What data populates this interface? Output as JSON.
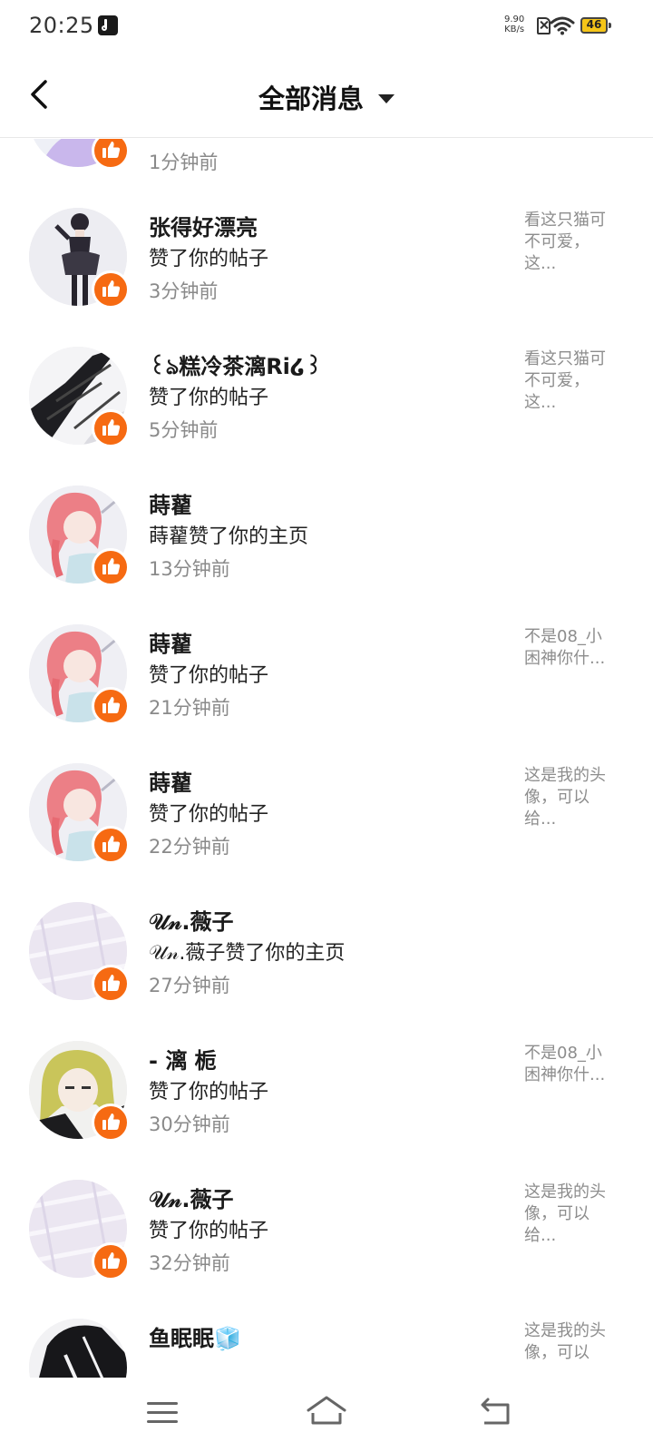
{
  "status_bar": {
    "time": "20:25",
    "net_speed_value": "9.90",
    "net_speed_unit": "KB/s",
    "battery": "46"
  },
  "header": {
    "title": "全部消息"
  },
  "colors": {
    "like_badge": "#f66a12",
    "preview_text": "#8d8d8d",
    "time_text": "#8a8a8a"
  },
  "messages": [
    {
      "name": "",
      "action": "",
      "time": "1分钟前",
      "preview": "",
      "avatar": "pink-lilac-avatar"
    },
    {
      "name": "张得好漂亮",
      "action": "赞了你的帖子",
      "time": "3分钟前",
      "preview": "看这只猫可\n不可爱，\n这...",
      "avatar": "black-dress-girl-avatar"
    },
    {
      "name": "꒰ঌ糕冷茶漓Ri໒꒱",
      "action": "赞了你的帖子",
      "time": "5分钟前",
      "preview": "看这只猫可\n不可爱，\n这...",
      "avatar": "sketch-bw-avatar"
    },
    {
      "name": "蒔藋",
      "action": "蒔藋赞了你的主页",
      "time": "13分钟前",
      "preview": "",
      "avatar": "pink-hair-girl-avatar"
    },
    {
      "name": "蒔藋",
      "action": "赞了你的帖子",
      "time": "21分钟前",
      "preview": "不是08_小\n困神你什...",
      "avatar": "pink-hair-girl-avatar"
    },
    {
      "name": "蒔藋",
      "action": "赞了你的帖子",
      "time": "22分钟前",
      "preview": "这是我的头\n像，可以\n给...",
      "avatar": "pink-hair-girl-avatar"
    },
    {
      "name": "𝒰𝓃.薇子",
      "action": "𝒰𝓃.薇子赞了你的主页",
      "time": "27分钟前",
      "preview": "",
      "avatar": "lavender-fabric-avatar"
    },
    {
      "name": "- 漓 栀",
      "action": "赞了你的帖子",
      "time": "30分钟前",
      "preview": "不是08_小\n困神你什...",
      "avatar": "blonde-girl-avatar"
    },
    {
      "name": "𝒰𝓃.薇子",
      "action": "赞了你的帖子",
      "time": "32分钟前",
      "preview": "这是我的头\n像，可以\n给...",
      "avatar": "lavender-fabric-avatar"
    },
    {
      "name": "鱼眠眠🧊",
      "action": "",
      "time": "",
      "preview": "这是我的头\n像，可以",
      "avatar": "dark-stripe-avatar"
    }
  ]
}
